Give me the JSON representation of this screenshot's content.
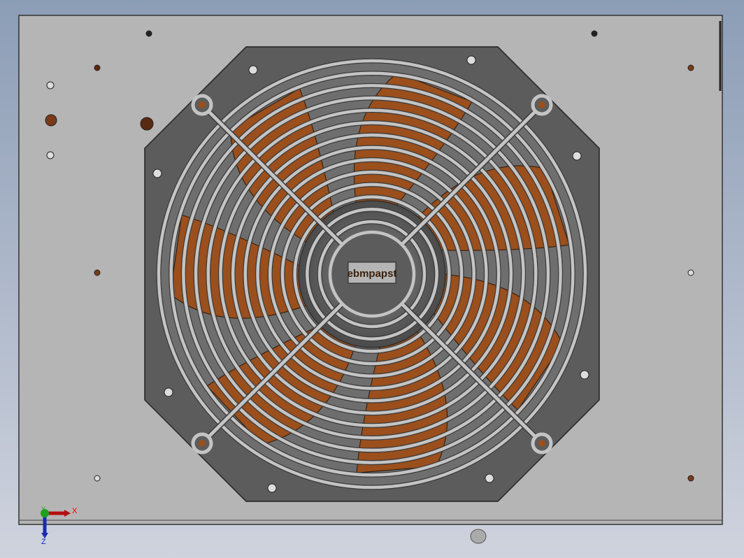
{
  "viewport": {
    "logo_text": "ebmpapst",
    "triad": {
      "x_label": "X",
      "y_label": "Y",
      "z_label": "Z"
    }
  },
  "colors": {
    "bg_top": "#8c9db6",
    "bg_bottom": "#cfd3de",
    "plate": "#b5b5b5",
    "housing": "#5c5c5c",
    "blade": "#9a4f1c",
    "guard": "#c4c4c4"
  },
  "model": {
    "guard_ring_count": 14,
    "blade_count": 7
  }
}
